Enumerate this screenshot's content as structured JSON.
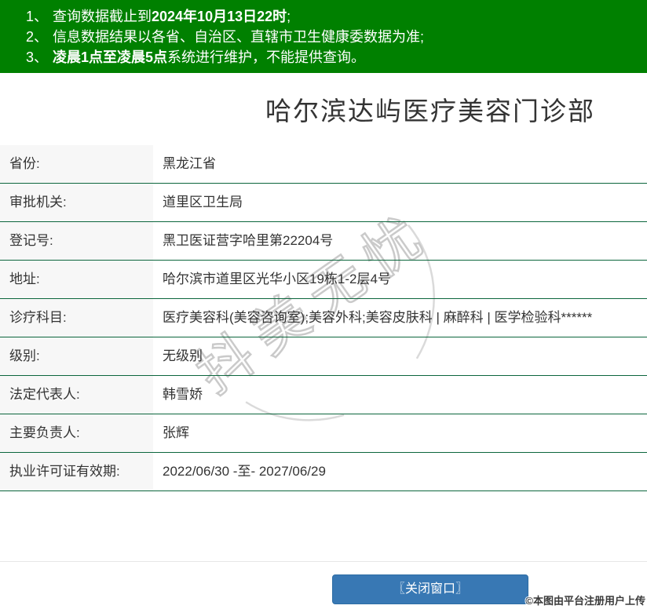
{
  "banner": {
    "bg_color": "#008000",
    "notices": [
      {
        "num": "1、",
        "pre": "查询数据截止到",
        "bold": "2024年10月13日22时",
        "post": ";"
      },
      {
        "num": "2、",
        "pre": "信息数据结果以各省、自治区、直辖市卫生健康委数据为准;",
        "bold": "",
        "post": ""
      },
      {
        "num": "3、",
        "pre": "",
        "bold": "凌晨1点至凌晨5点",
        "post": "系统进行维护，不能提供查询。"
      }
    ]
  },
  "header": {
    "title": "哈尔滨达屿医疗美容门诊部"
  },
  "info": {
    "rows": [
      {
        "label": "省份:",
        "value": "黑龙江省"
      },
      {
        "label": "审批机关:",
        "value": "道里区卫生局"
      },
      {
        "label": "登记号:",
        "value": "黑卫医证营字哈里第22204号"
      },
      {
        "label": "地址:",
        "value": "哈尔滨市道里区光华小区19栋1-2层4号"
      },
      {
        "label": "诊疗科目:",
        "value": "医疗美容科(美容咨询室);美容外科;美容皮肤科 | 麻醉科 | 医学检验科******"
      },
      {
        "label": "级别:",
        "value": "无级别"
      },
      {
        "label": "法定代表人:",
        "value": "韩雪娇"
      },
      {
        "label": "主要负责人:",
        "value": "张辉"
      },
      {
        "label": "执业许可证有效期:",
        "value": "2022/06/30 -至- 2027/06/29"
      }
    ]
  },
  "watermark": {
    "text": "抖美无忧"
  },
  "footer": {
    "close_button_label": "〖关闭窗口〗",
    "copyright": "©本图由平台注册用户上传"
  },
  "colors": {
    "banner_green": "#008000",
    "divider_green": "#0c663d",
    "label_bg": "#f7f7f7",
    "button_blue": "#3878b4",
    "text": "#333333"
  }
}
